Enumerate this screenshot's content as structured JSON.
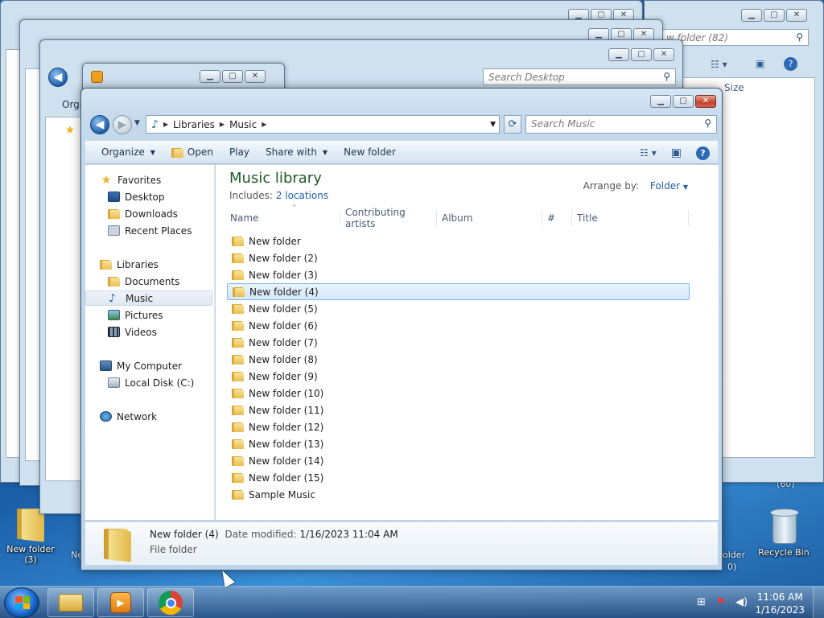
{
  "desktop": {
    "icons": [
      {
        "label": "New folder",
        "sublabel": "(3)"
      },
      {
        "label": "Recycle Bin"
      }
    ],
    "partial_labels": {
      "ne": "Ne",
      "older": "older",
      "older_sub": "0)",
      "count_badge": "(60)"
    }
  },
  "bg_windows": {
    "w1": {
      "search_placeholder": "w folder (82)",
      "col_size": "Size"
    },
    "w3": {
      "search_placeholder": "Search Desktop",
      "org": "Orga"
    }
  },
  "window": {
    "address": {
      "crumbs": [
        "Libraries",
        "Music"
      ]
    },
    "search_placeholder": "Search Music",
    "toolbar": {
      "organize": "Organize",
      "open": "Open",
      "play": "Play",
      "share_with": "Share with",
      "new_folder": "New folder"
    },
    "nav": {
      "favorites": "Favorites",
      "desktop": "Desktop",
      "downloads": "Downloads",
      "recent_places": "Recent Places",
      "libraries": "Libraries",
      "documents": "Documents",
      "music": "Music",
      "pictures": "Pictures",
      "videos": "Videos",
      "my_computer": "My Computer",
      "local_disk": "Local Disk (C:)",
      "network": "Network"
    },
    "library": {
      "title": "Music library",
      "includes_label": "Includes:",
      "includes_link": "2 locations",
      "arrange_label": "Arrange by:",
      "arrange_value": "Folder"
    },
    "columns": [
      "Name",
      "Contributing artists",
      "Album",
      "#",
      "Title"
    ],
    "files": [
      "New folder",
      "New folder (2)",
      "New folder (3)",
      "New folder (4)",
      "New folder (5)",
      "New folder (6)",
      "New folder (7)",
      "New folder (8)",
      "New folder (9)",
      "New folder (10)",
      "New folder (11)",
      "New folder (12)",
      "New folder (13)",
      "New folder (14)",
      "New folder (15)",
      "Sample Music"
    ],
    "selected_file": "New folder (4)",
    "details": {
      "name": "New folder (4)",
      "modified_label": "Date modified:",
      "modified_value": "1/16/2023 11:04 AM",
      "type": "File folder"
    }
  },
  "taskbar": {
    "time": "11:06 AM",
    "date": "1/16/2023"
  },
  "colors": {
    "accent": "#1d5fab",
    "library_title": "#1e5a24",
    "selection": "#d3e8fc"
  }
}
